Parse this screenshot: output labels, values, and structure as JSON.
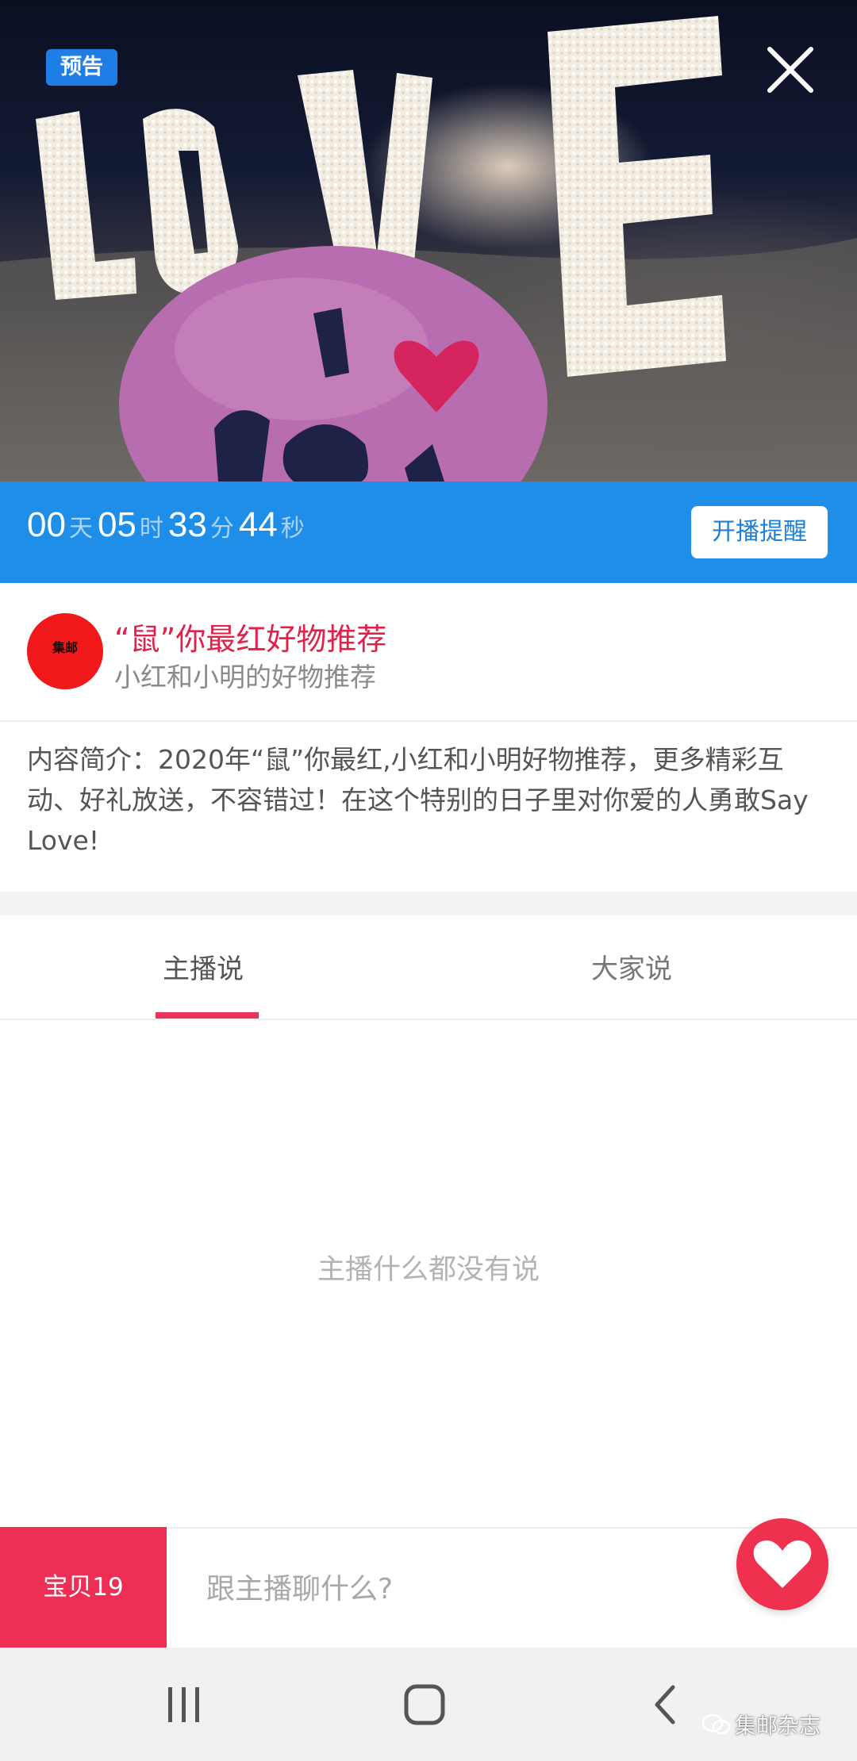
{
  "hero": {
    "badge": "预告",
    "image_text": "LOVE",
    "balloon_text": "I ❤ You"
  },
  "countdown": {
    "days": "00",
    "days_unit": "天",
    "hours": "05",
    "hours_unit": "时",
    "minutes": "33",
    "minutes_unit": "分",
    "seconds": "44",
    "seconds_unit": "秒",
    "remind_label": "开播提醒"
  },
  "host": {
    "avatar_text": "集邮",
    "title": "“鼠”你最红好物推荐",
    "name": "小红和小明的好物推荐"
  },
  "intro": "内容简介：2020年“鼠”你最红,小红和小明好物推荐，更多精彩互动、好礼放送，不容错过！在这个特别的日子里对你爱的人勇敢Say Love!",
  "tabs": [
    {
      "label": "主播说",
      "active": true
    },
    {
      "label": "大家说",
      "active": false
    }
  ],
  "empty_message": "主播什么都没有说",
  "bottom": {
    "products_label": "宝贝19",
    "chat_placeholder": "跟主播聊什么?"
  },
  "watermark": "集邮杂志",
  "colors": {
    "accent_pink": "#ee2e55",
    "countdown_blue": "#1e8ee9",
    "badge_blue": "#1f7de6"
  }
}
